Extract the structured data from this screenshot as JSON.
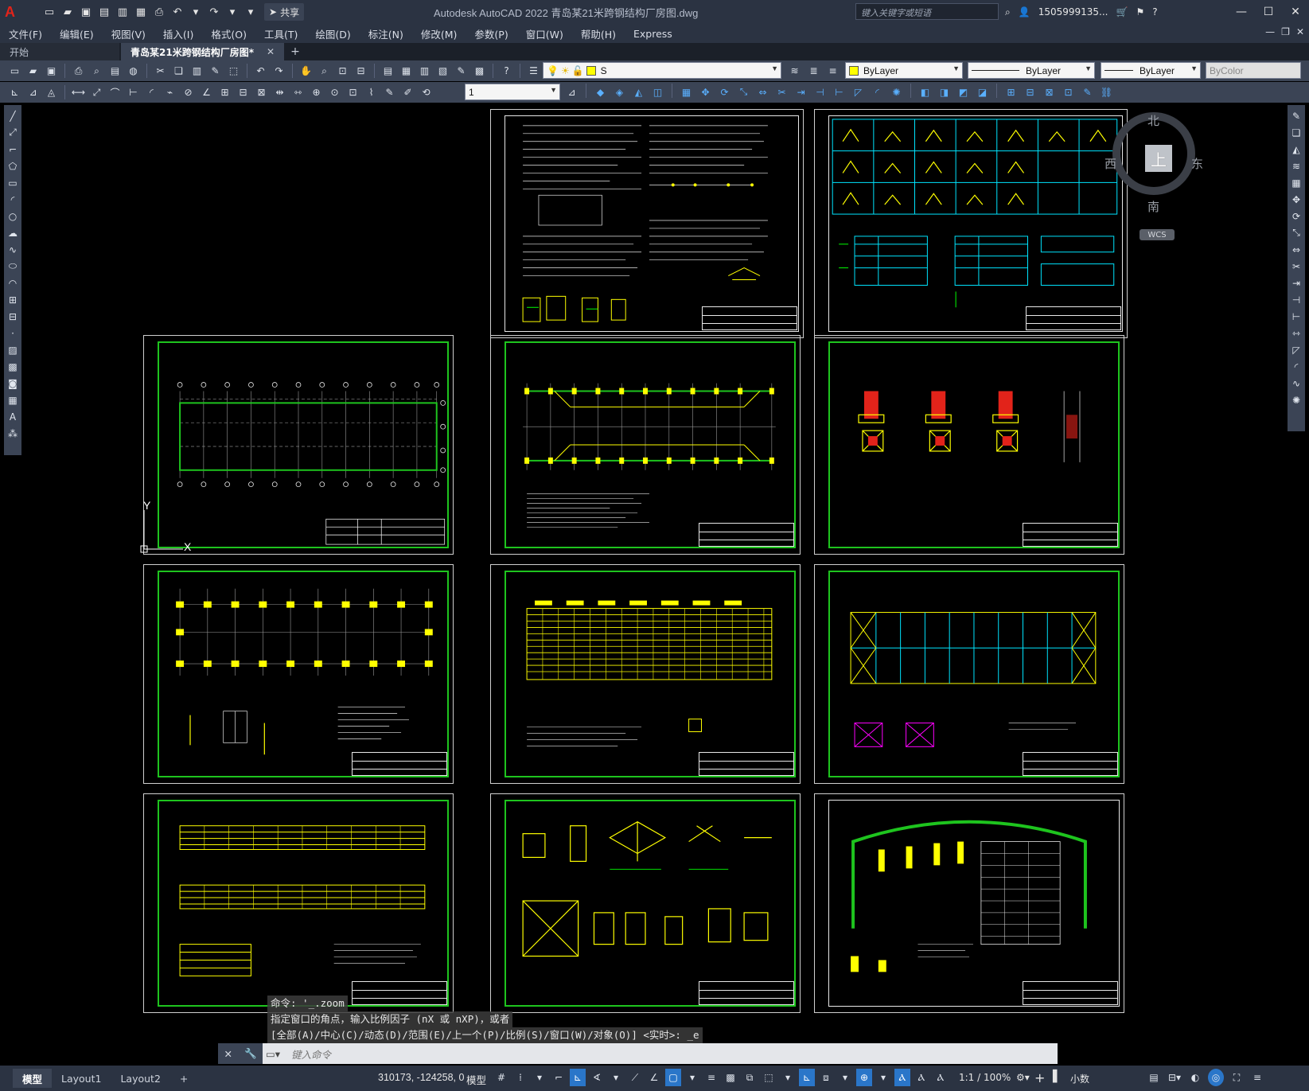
{
  "app": {
    "logo_glyph": "A",
    "title": "Autodesk AutoCAD 2022    青岛某21米跨钢结构厂房图.dwg",
    "share_label": "共享",
    "search_placeholder": "键入关键字或短语",
    "user": "1505999135...",
    "window_controls": [
      "—",
      "☐",
      "✕"
    ]
  },
  "menu": {
    "items": [
      "文件(F)",
      "编辑(E)",
      "视图(V)",
      "插入(I)",
      "格式(O)",
      "工具(T)",
      "绘图(D)",
      "标注(N)",
      "修改(M)",
      "参数(P)",
      "窗口(W)",
      "帮助(H)",
      "Express"
    ]
  },
  "tabs": {
    "start": "开始",
    "drawing": "青岛某21米跨钢结构厂房图*",
    "close": "✕",
    "add": "+"
  },
  "toolbar": {
    "layer": "S",
    "color": "ByLayer",
    "linetype": "ByLayer",
    "lineweight": "ByLayer",
    "plotstyle": "ByColor",
    "dimscale": "1"
  },
  "viewcube": {
    "top": "上",
    "north": "北",
    "south": "南",
    "east": "东",
    "west": "西",
    "wcs": "WCS"
  },
  "ucs": {
    "x": "X",
    "y": "Y"
  },
  "command": {
    "history": [
      "命令: '_.zoom",
      "指定窗口的角点，输入比例因子 (nX 或 nXP)，或者",
      "[全部(A)/中心(C)/动态(D)/范围(E)/上一个(P)/比例(S)/窗口(W)/对象(O)] <实时>: _e"
    ],
    "placeholder": "键入命令"
  },
  "status": {
    "layouts": [
      "模型",
      "Layout1",
      "Layout2"
    ],
    "add": "+",
    "coords": "310173, -124258, 0",
    "model": "模型",
    "scale": "1:1 / 100%",
    "units": "小数"
  },
  "colors": {
    "frame_green": "#1ec41e",
    "drawing_yellow": "#ffff00",
    "drawing_cyan": "#00e5ff",
    "drawing_magenta": "#ff00ff",
    "ui_dark": "#2b3342",
    "ui_mid": "#3b4455"
  }
}
